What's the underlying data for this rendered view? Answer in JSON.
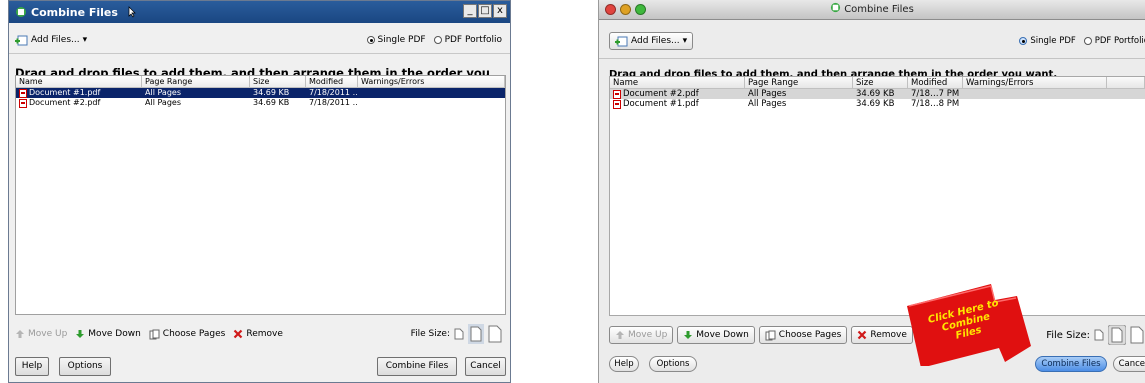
{
  "windows_dialog": {
    "title": "Combine Files",
    "title_buttons": [
      "_",
      "□",
      "x"
    ],
    "add_files_label": "Add Files...",
    "output_options": [
      {
        "label": "Single PDF",
        "selected": true
      },
      {
        "label": "PDF Portfolio",
        "selected": false
      }
    ],
    "instructions": "Drag and drop files to add them, and then arrange them in the order you want.",
    "columns": [
      "Name",
      "Page Range",
      "Size",
      "Modified",
      "Warnings/Errors"
    ],
    "rows": [
      {
        "name": "Document #1.pdf",
        "range": "All Pages",
        "size": "34.69 KB",
        "modified": "7/18/2011 ...",
        "warnings": "",
        "selected": true
      },
      {
        "name": "Document #2.pdf",
        "range": "All Pages",
        "size": "34.69 KB",
        "modified": "7/18/2011 ...",
        "warnings": "",
        "selected": false
      }
    ],
    "actions": {
      "move_up": "Move Up",
      "move_down": "Move Down",
      "choose_pages": "Choose Pages",
      "remove": "Remove"
    },
    "file_size_label": "File Size:",
    "buttons": {
      "help": "Help",
      "options": "Options",
      "combine": "Combine Files",
      "cancel": "Cancel"
    }
  },
  "mac_dialog": {
    "title": "Combine Files",
    "add_files_label": "Add Files...",
    "output_options": [
      {
        "label": "Single PDF",
        "selected": true
      },
      {
        "label": "PDF Portfolio",
        "selected": false
      }
    ],
    "instructions": "Drag and drop files to add them, and then arrange them in the order you want.",
    "columns": [
      "Name",
      "Page Range",
      "Size",
      "Modified",
      "Warnings/Errors"
    ],
    "rows": [
      {
        "name": "Document #2.pdf",
        "range": "All Pages",
        "size": "34.69 KB",
        "modified": "7/18…7 PM",
        "warnings": "",
        "selected": true
      },
      {
        "name": "Document #1.pdf",
        "range": "All Pages",
        "size": "34.69 KB",
        "modified": "7/18…8 PM",
        "warnings": "",
        "selected": false
      }
    ],
    "actions": {
      "move_up": "Move Up",
      "move_down": "Move Down",
      "choose_pages": "Choose Pages",
      "remove": "Remove"
    },
    "file_size_label": "File Size:",
    "buttons": {
      "help": "Help",
      "options": "Options",
      "combine": "Combine Files",
      "cancel": "Cancel"
    },
    "callout": "Click Here to Combine Files"
  },
  "colors": {
    "win_titlebar": "#1a4782",
    "win_selection": "#0a246a",
    "mac_primary": "#4c8ee6",
    "callout_red": "#e01010",
    "callout_text": "#ffe600"
  }
}
